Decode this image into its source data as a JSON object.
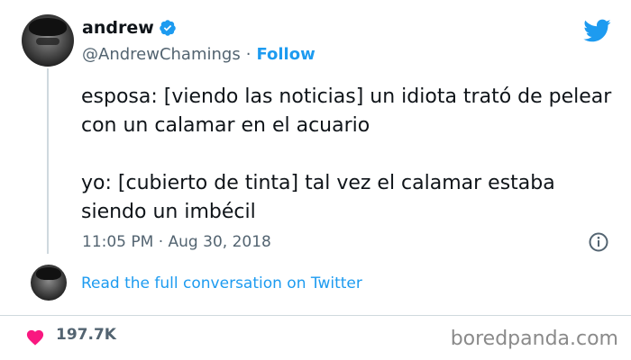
{
  "tweet": {
    "author_name": "andrew",
    "handle": "@AndrewChamings",
    "separator": "·",
    "follow_label": "Follow",
    "paragraphs": [
      "esposa: [viendo las noticias] un idiota trató de pelear con un calamar en el acuario",
      "yo: [cubierto de tinta] tal vez el calamar estaba siendo un imbécil"
    ],
    "timestamp": "11:05 PM · Aug 30, 2018",
    "read_full_label": "Read the full conversation on Twitter",
    "likes": "197.7K"
  },
  "icons": {
    "verified": "verified-badge-icon",
    "brand": "twitter-bird-icon",
    "info": "info-icon",
    "like": "heart-icon"
  },
  "watermark": "boredpanda.com",
  "colors": {
    "brand_blue": "#1d9bf0",
    "heart_pink": "#f91880",
    "muted_text": "#536471"
  }
}
